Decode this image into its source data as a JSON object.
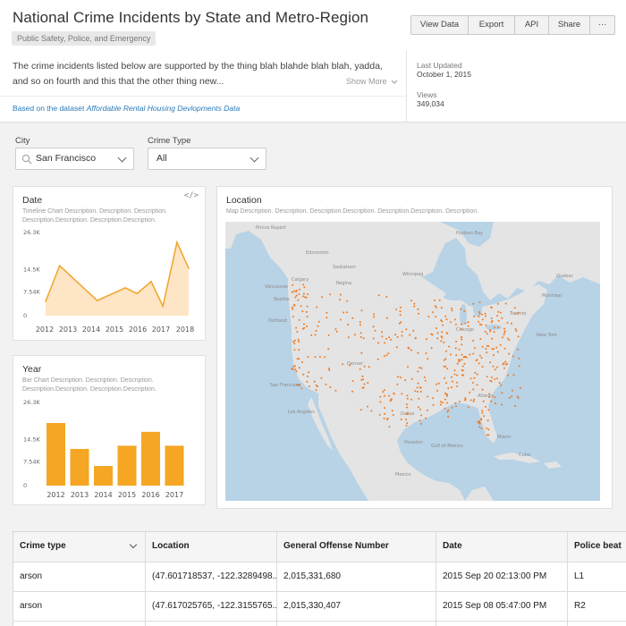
{
  "header": {
    "title": "National Crime Incidents by State and Metro-Region",
    "category": "Public Safety, Police, and Emergency",
    "buttons": [
      "View Data",
      "Export",
      "API",
      "Share",
      "···"
    ],
    "description_line1": "The crime incidents listed below are supported by the thing blah blahde blah blah, yadda,",
    "description_line2": "and so on fourth and this that the other thing new...",
    "show_more": "Show More",
    "dataset_prefix": "Based on the dataset",
    "dataset_name": "Affordable Rental Housing Devlopments Data",
    "last_updated_label": "Last Updated",
    "last_updated_value": "October 1, 2015",
    "views_label": "Views",
    "views_value": "349,034"
  },
  "filters": {
    "city_label": "City",
    "city_value": "San Francisco",
    "crime_type_label": "Crime Type",
    "crime_type_value": "All"
  },
  "timeline_card": {
    "title": "Date",
    "desc_line1": "Timeline Chart Description. Description. Description.",
    "desc_line2": "Description.Description. Description.Description."
  },
  "bar_card": {
    "title": "Year",
    "desc_line1": "Bar Chart Description. Description. Description.",
    "desc_line2": "Description.Description. Description.Description."
  },
  "map_card": {
    "title": "Location",
    "desc": "Map Description. Description. Description.Description. Description.Description. Description."
  },
  "chart_data": [
    {
      "type": "area",
      "title": "Date",
      "x": [
        "2012",
        "2013",
        "2014",
        "2015",
        "2016",
        "2017",
        "2018"
      ],
      "y_ticks": [
        "26.3K",
        "14.5K",
        "7.54K",
        "0"
      ],
      "values": [
        {
          "x": 2012.0,
          "y": 4500
        },
        {
          "x": 2012.6,
          "y": 15800
        },
        {
          "x": 2014.2,
          "y": 4800
        },
        {
          "x": 2015.4,
          "y": 8800
        },
        {
          "x": 2015.9,
          "y": 7000
        },
        {
          "x": 2016.5,
          "y": 10800
        },
        {
          "x": 2017.0,
          "y": 3000
        },
        {
          "x": 2017.6,
          "y": 23200
        },
        {
          "x": 2018.1,
          "y": 15000
        }
      ],
      "ylim": [
        0,
        26300
      ],
      "color": "#f0a832",
      "fill": "#fde5c6"
    },
    {
      "type": "bar",
      "title": "Year",
      "categories": [
        "2012",
        "2013",
        "2014",
        "2015",
        "2016",
        "2017"
      ],
      "values": [
        19800,
        11600,
        6200,
        12600,
        17000,
        12600
      ],
      "y_ticks": [
        "26.3K",
        "14.5K",
        "7.54K",
        "0"
      ],
      "ylim": [
        0,
        26300
      ],
      "color": "#f5a623"
    }
  ],
  "map": {
    "labels": [
      "Prince Rupert",
      "Winnipeg",
      "Calgary",
      "Edmonton",
      "Regina",
      "Saskatoon",
      "Vancouver",
      "Seattle",
      "Portland",
      "San Francisco",
      "Los Angeles",
      "Denver",
      "Dallas",
      "Houston",
      "Chicago",
      "Toronto",
      "Montreal",
      "New York",
      "Atlanta",
      "Miami",
      "Mexico",
      "Gulf of Mexico",
      "Cuba",
      "Hudson Bay",
      "Quebec"
    ],
    "land_color": "#e4e4e4",
    "water_color": "#b8d2e6",
    "dot_color": "#f07a20"
  },
  "table": {
    "columns": [
      "Crime type",
      "Location",
      "General Offense Number",
      "Date",
      "Police beat"
    ],
    "rows": [
      [
        "arson",
        "(47.601718537, -122.3289498...",
        "2,015,331,680",
        "2015 Sep 20 02:13:00 PM",
        "L1"
      ],
      [
        "arson",
        "(47.617025765, -122.3155765...",
        "2,015,330,407",
        "2015 Sep 08 05:47:00 PM",
        "R2"
      ]
    ]
  }
}
